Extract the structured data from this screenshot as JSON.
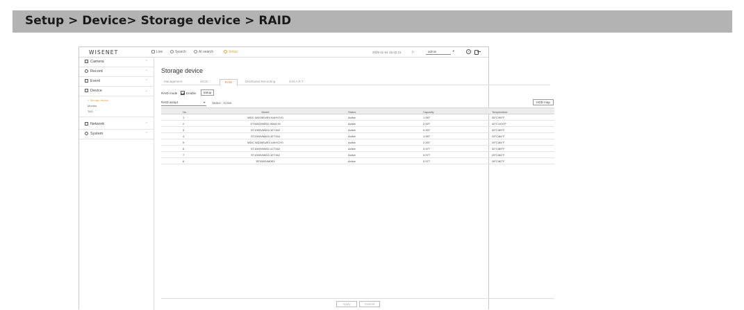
{
  "header": {
    "title": "Setup > Device> Storage device > RAID"
  },
  "topnav": {
    "logo": "WISENET",
    "live": "Live",
    "search": "Search",
    "ai_search": "AI search",
    "setup": "Setup",
    "datetime": "2025-11-04 15:42:21",
    "user": "admin",
    "help": "?"
  },
  "sidebar": {
    "items": [
      {
        "label": "Camera",
        "icon": "camera-icon"
      },
      {
        "label": "Record",
        "icon": "record-icon"
      },
      {
        "label": "Event",
        "icon": "event-icon"
      },
      {
        "label": "Device",
        "icon": "device-icon"
      },
      {
        "label": "Network",
        "icon": "network-icon"
      },
      {
        "label": "System",
        "icon": "system-icon"
      }
    ],
    "device_sub": [
      "Storage device",
      "Monitor",
      "TAS"
    ]
  },
  "main": {
    "page_title": "Storage device",
    "tabs": [
      "Management",
      "iSCSI",
      "RAID",
      "Distributed Recording",
      "S.M.A.R.T"
    ],
    "active_tab": "RAID",
    "raid_mode_label": "RAID mode",
    "enable_label": "Enable",
    "setup_button": "Setup",
    "raid_select_value": "RAID array1",
    "status_text": "Status : Active",
    "hdd_map_button": "HDD map"
  },
  "table": {
    "columns": [
      "No.",
      "Model",
      "Status",
      "Capacity",
      "Temperature"
    ],
    "rows": [
      [
        "1",
        "WDC WD20EURX-64HYZY0",
        "Active",
        "1.95T",
        "35°C/95°F"
      ],
      [
        "2",
        "ST3000VM002-9DM178",
        "Active",
        "2.92T",
        "40°C/104°F"
      ],
      [
        "3",
        "ST1000VM002-1ET162",
        "Active",
        "0.93T",
        "32°C/89°F"
      ],
      [
        "4",
        "ST2000VM003-1ET164",
        "Active",
        "1.95T",
        "29°C/84°F"
      ],
      [
        "5",
        "WDC WD30EURX-64HYZY0",
        "Active",
        "2.93T",
        "29°C/84°F"
      ],
      [
        "6",
        "ST1000VM002-1CT162",
        "Active",
        "0.97T",
        "32°C/89°F"
      ],
      [
        "7",
        "ST1000VM002-1ET162",
        "Active",
        "0.97T",
        "29°C/84°F"
      ],
      [
        "8",
        "SF3000VM0R3",
        "Active",
        "0.97T",
        "28°C/82°F"
      ]
    ]
  },
  "footer": {
    "apply": "Apply",
    "cancel": "Cancel"
  }
}
